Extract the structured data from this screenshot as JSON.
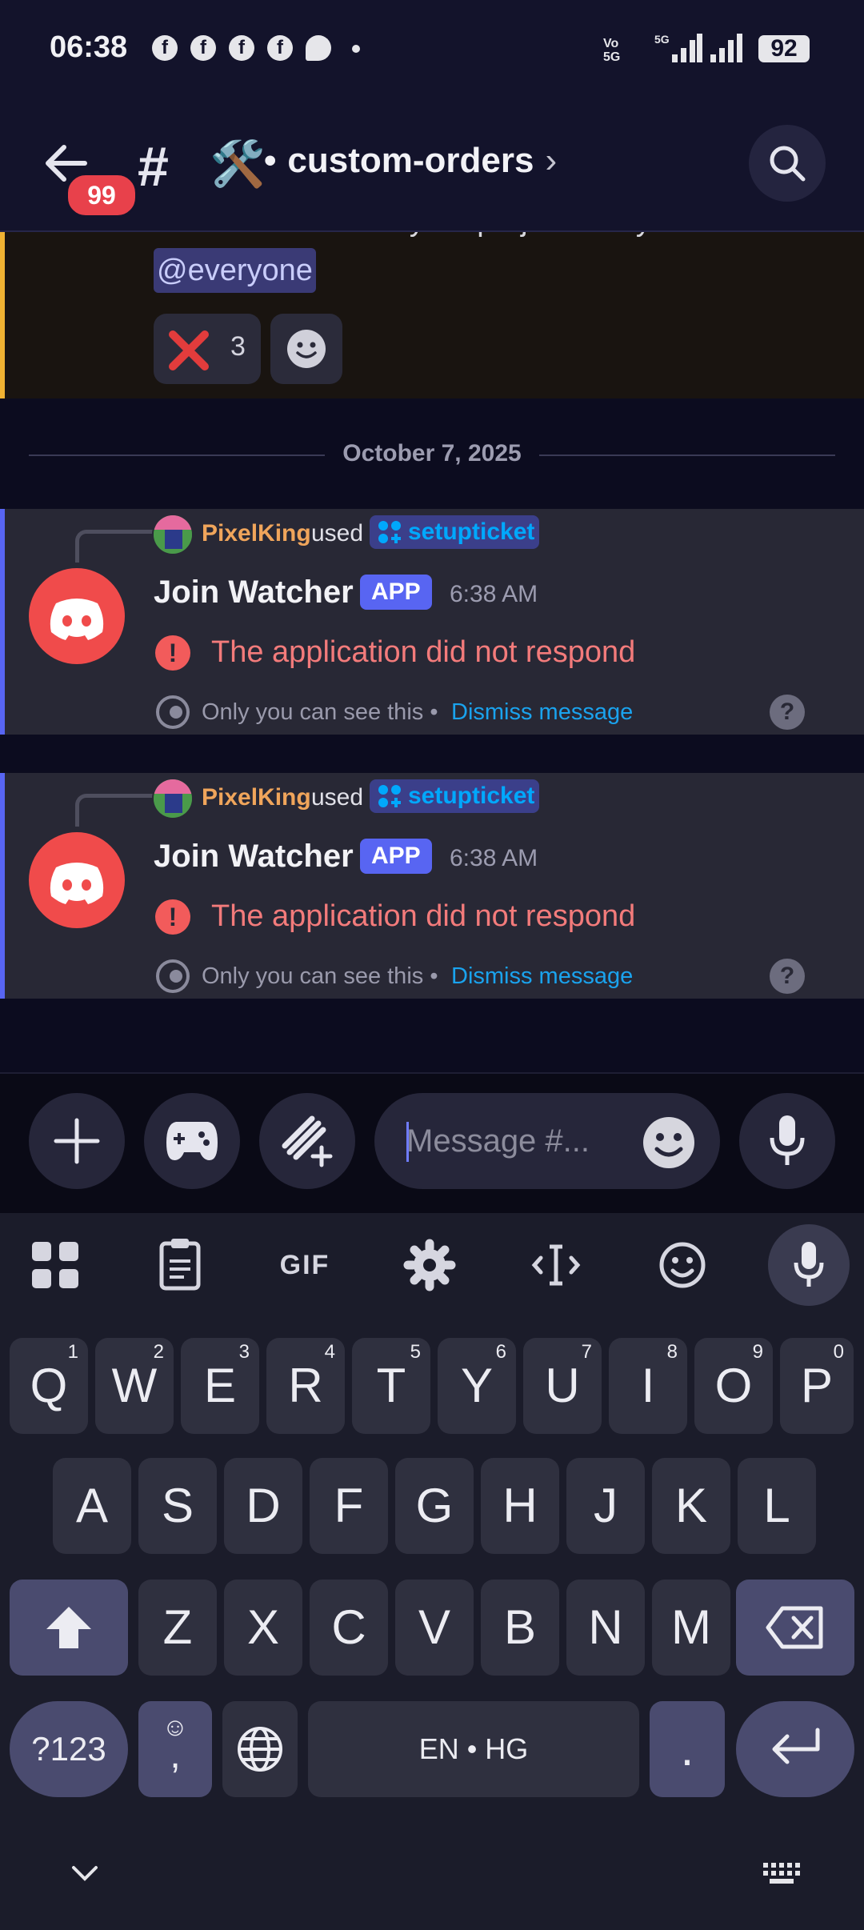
{
  "status_bar": {
    "time": "06:38",
    "notification_icons": [
      "facebook-icon",
      "facebook-icon",
      "facebook-icon",
      "facebook-icon",
      "messenger-icon",
      "dot-icon"
    ],
    "network": "Vo 5G",
    "network_type": "5G",
    "battery": "92"
  },
  "header": {
    "unread_badge": "99",
    "channel_icon": "🛠️",
    "separator": "•",
    "channel_name": "custom-orders"
  },
  "messages": {
    "cutoff_text": "✉️ DM us to order your project today!",
    "mention": "@everyone",
    "reaction_emoji": "❌",
    "reaction_count": "3",
    "date_separator": "October 7, 2025",
    "items": [
      {
        "reply_user": "PixelKing",
        "reply_used": "used",
        "command": "setupticket",
        "author": "Join Watcher",
        "tag": "APP",
        "time": "6:38 AM",
        "error": "The application did not respond",
        "ephemeral": "Only you can see this •",
        "dismiss": "Dismiss message",
        "help": "?"
      },
      {
        "reply_user": "PixelKing",
        "reply_used": "used",
        "command": "setupticket",
        "author": "Join Watcher",
        "tag": "APP",
        "time": "6:38 AM",
        "error": "The application did not respond",
        "ephemeral": "Only you can see this •",
        "dismiss": "Dismiss message",
        "help": "?"
      }
    ]
  },
  "composer": {
    "placeholder": "Message #..."
  },
  "keyboard": {
    "toolbar": [
      "apps-grid-icon",
      "clipboard-icon",
      "gif-icon",
      "settings-icon",
      "cursor-move-icon",
      "emoji-icon",
      "mic-icon"
    ],
    "gif_label": "GIF",
    "row1": [
      {
        "k": "Q",
        "n": "1"
      },
      {
        "k": "W",
        "n": "2"
      },
      {
        "k": "E",
        "n": "3"
      },
      {
        "k": "R",
        "n": "4"
      },
      {
        "k": "T",
        "n": "5"
      },
      {
        "k": "Y",
        "n": "6"
      },
      {
        "k": "U",
        "n": "7"
      },
      {
        "k": "I",
        "n": "8"
      },
      {
        "k": "O",
        "n": "9"
      },
      {
        "k": "P",
        "n": "0"
      }
    ],
    "row2": [
      "A",
      "S",
      "D",
      "F",
      "G",
      "H",
      "J",
      "K",
      "L"
    ],
    "row3": [
      "Z",
      "X",
      "C",
      "V",
      "B",
      "N",
      "M"
    ],
    "symbols": "?123",
    "comma_emoji": "☺",
    "comma": ",",
    "space": "EN • HG",
    "period": "."
  }
}
